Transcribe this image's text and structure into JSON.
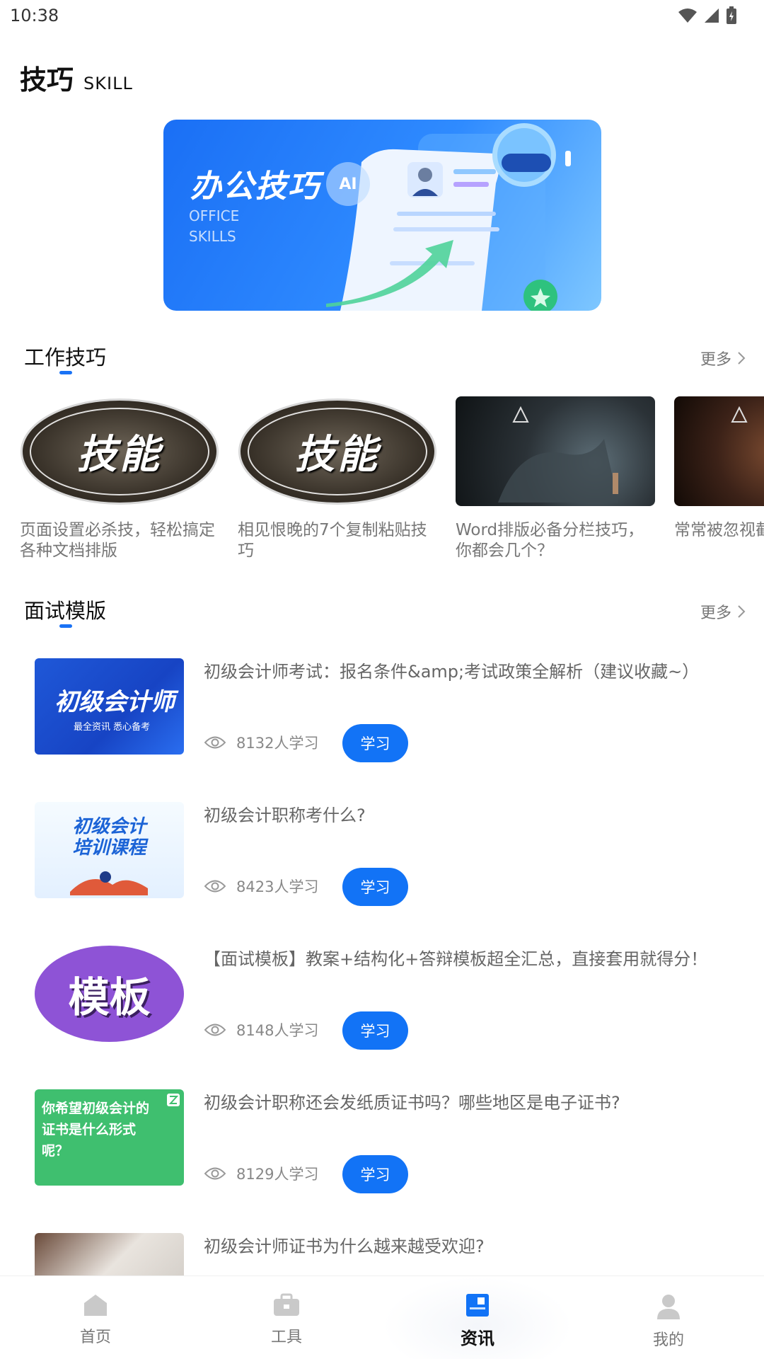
{
  "status_bar": {
    "time": "10:38"
  },
  "header": {
    "title": "技巧",
    "subtitle": "SKILL"
  },
  "banner": {
    "title": "办公技巧",
    "ai_badge": "AI",
    "subtitle": "OFFICE\nSKILLS"
  },
  "work_skills": {
    "title": "工作技巧",
    "more": "更多",
    "cards": [
      {
        "thumb_text": "技能",
        "title": "页面设置必杀技，轻松搞定各种文档排版"
      },
      {
        "thumb_text": "技能",
        "title": "相见恨晚的7个复制粘贴技巧"
      },
      {
        "thumb_text": "",
        "title": "Word排版必备分栏技巧，你都会几个？"
      },
      {
        "thumb_text": "",
        "title": "常常被忽视截图，你会"
      }
    ]
  },
  "interview": {
    "title": "面试模版",
    "more": "更多",
    "items": [
      {
        "thumb_big": "初级会计师",
        "thumb_small": "最全资讯 悉心备考",
        "title": "初级会计师考试：报名条件&amp;考试政策全解析（建议收藏~）",
        "views": "8132人学习",
        "button": "学习"
      },
      {
        "thumb_big": "初级会计\n培训课程",
        "thumb_small": "",
        "title": "初级会计职称考什么?",
        "views": "8423人学习",
        "button": "学习"
      },
      {
        "thumb_big": "模板",
        "thumb_small": "",
        "title": "【面试模板】教案+结构化+答辩模板超全汇总，直接套用就得分！",
        "views": "8148人学习",
        "button": "学习"
      },
      {
        "thumb_big": "你希望初级会计的证书是什么形式呢？",
        "thumb_small": "",
        "title": "初级会计职称还会发纸质证书吗？哪些地区是电子证书?",
        "views": "8129人学习",
        "button": "学习"
      },
      {
        "thumb_big": "",
        "thumb_small": "",
        "title": "初级会计师证书为什么越来越受欢迎?",
        "views": "",
        "button": ""
      }
    ]
  },
  "bottom_nav": {
    "items": [
      {
        "label": "首页",
        "icon": "home-icon"
      },
      {
        "label": "工具",
        "icon": "toolbox-icon"
      },
      {
        "label": "资讯",
        "icon": "news-icon",
        "active": true
      },
      {
        "label": "我的",
        "icon": "profile-icon"
      }
    ]
  },
  "colors": {
    "accent": "#1273f6",
    "text_muted": "#777777"
  }
}
